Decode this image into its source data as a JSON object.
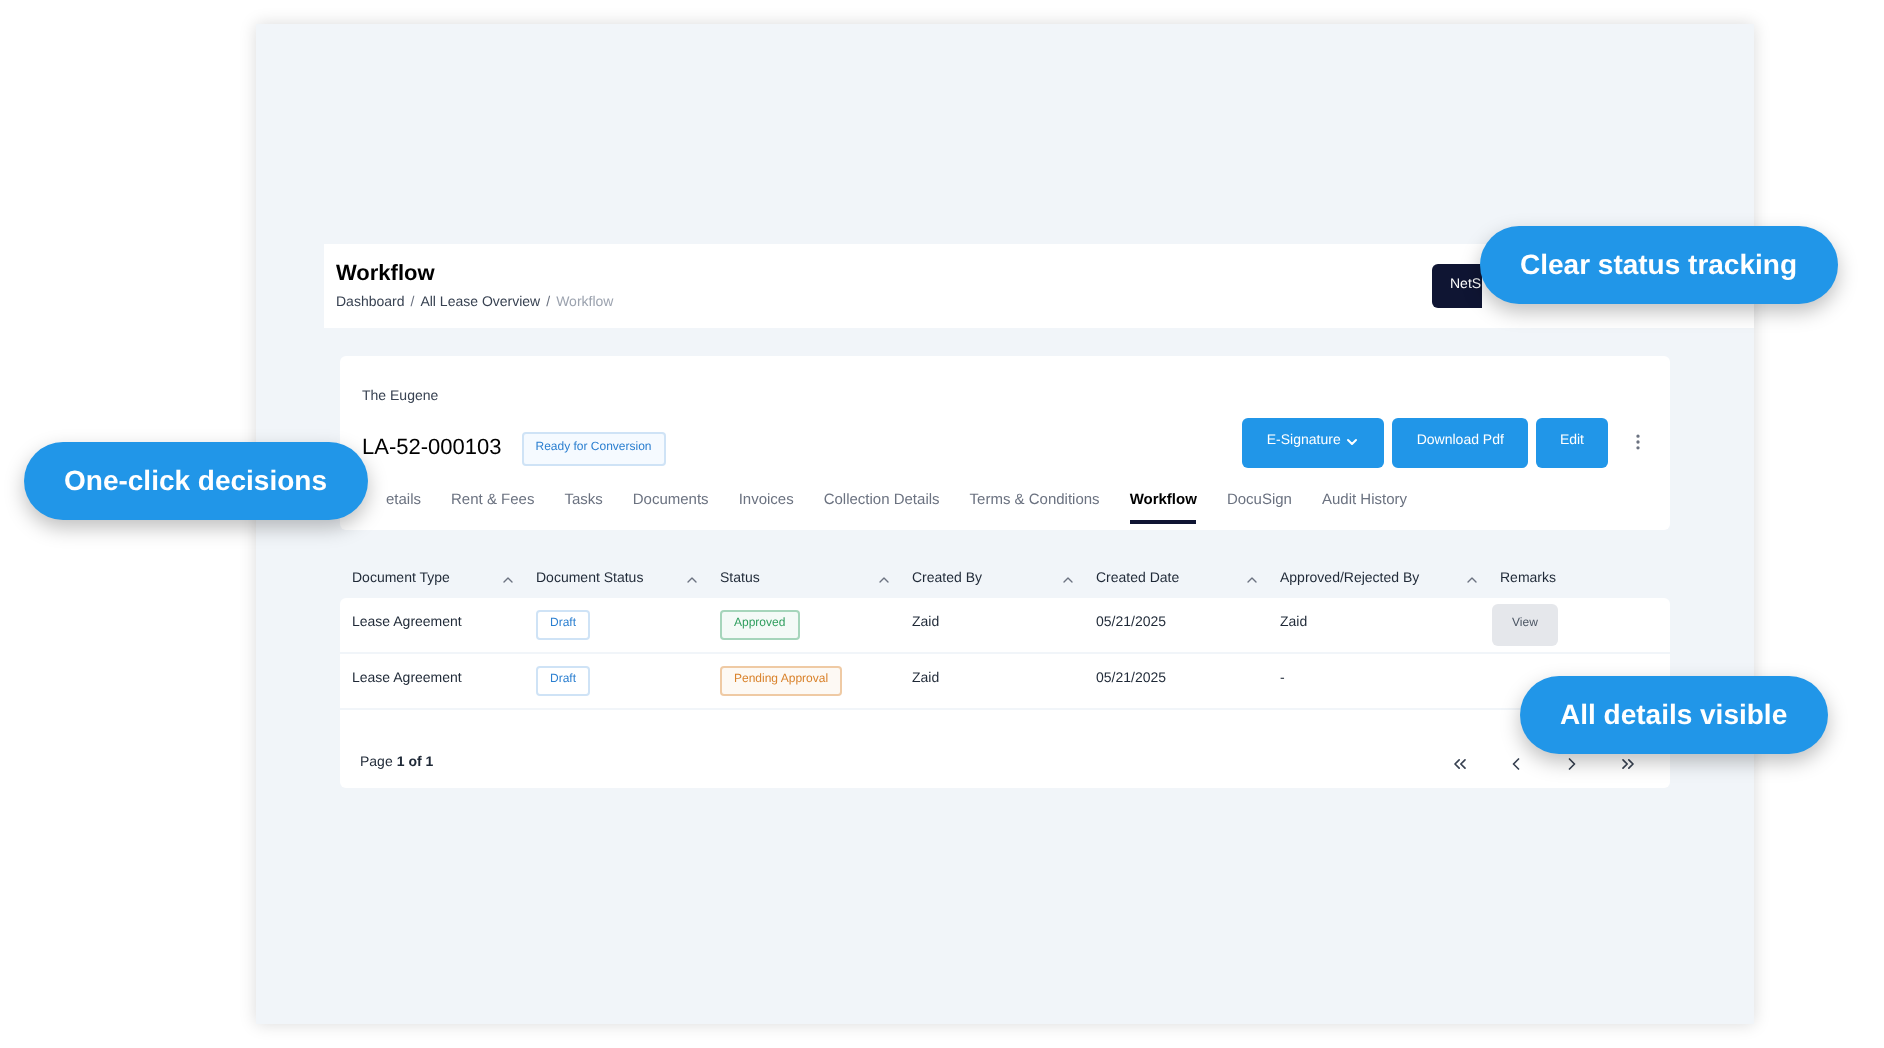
{
  "header": {
    "title": "Workflow",
    "breadcrumb_separator": "/",
    "breadcrumb": [
      {
        "label": "Dashboard",
        "current": false
      },
      {
        "label": "All Lease Overview",
        "current": false
      },
      {
        "label": "Workflow",
        "current": true
      }
    ],
    "action_button": "NetS"
  },
  "record": {
    "property": "The Eugene",
    "id": "LA-52-000103",
    "badge": "Ready for Conversion",
    "buttons": [
      {
        "label": "E-Signature",
        "kind": "dropdown"
      },
      {
        "label": "Download Pdf",
        "kind": "plain"
      },
      {
        "label": "Edit",
        "kind": "plain"
      }
    ],
    "tabs": [
      {
        "label": "etails",
        "selected": false
      },
      {
        "label": "Rent & Fees",
        "selected": false
      },
      {
        "label": "Tasks",
        "selected": false
      },
      {
        "label": "Documents",
        "selected": false
      },
      {
        "label": "Invoices",
        "selected": false
      },
      {
        "label": "Collection Details",
        "selected": false
      },
      {
        "label": "Terms & Conditions",
        "selected": false
      },
      {
        "label": "Workflow",
        "selected": true
      },
      {
        "label": "DocuSign",
        "selected": false
      },
      {
        "label": "Audit History",
        "selected": false
      }
    ]
  },
  "table": {
    "columns": [
      {
        "label": "Document Type",
        "sortable": true
      },
      {
        "label": "Document Status",
        "sortable": true
      },
      {
        "label": "Status",
        "sortable": true
      },
      {
        "label": "Created By",
        "sortable": true
      },
      {
        "label": "Created Date",
        "sortable": true
      },
      {
        "label": "Approved/Rejected By",
        "sortable": true
      },
      {
        "label": "Remarks",
        "sortable": false
      }
    ],
    "rows": [
      {
        "document_type": "Lease Agreement",
        "document_status": "Draft",
        "status": "Approved",
        "color": "#2f9e5e",
        "created_by": "Zaid",
        "created_date": "05/21/2025",
        "approved_by": "Zaid",
        "remarks": "View"
      },
      {
        "document_type": "Lease Agreement",
        "document_status": "Draft",
        "status": "Pending Approval",
        "color": "#d9822b",
        "created_by": "Zaid",
        "created_date": "05/21/2025",
        "approved_by": "-"
      }
    ],
    "page_label": "Page",
    "page_value": "1 of 1"
  },
  "callouts": [
    "Clear status tracking",
    "One-click decisions",
    "All details visible"
  ]
}
